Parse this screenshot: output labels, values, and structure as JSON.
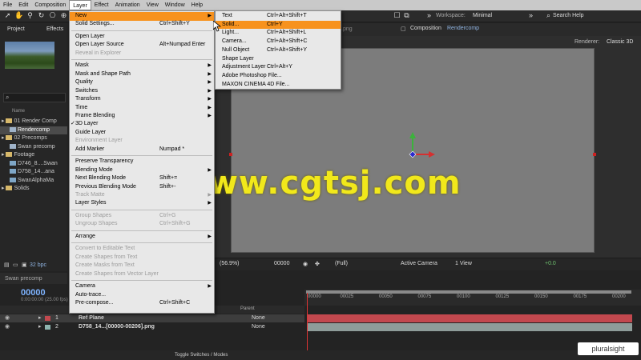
{
  "menubar": {
    "items": [
      "File",
      "Edit",
      "Composition",
      "Layer",
      "Effect",
      "Animation",
      "View",
      "Window",
      "Help"
    ],
    "active": "Layer"
  },
  "toolbar": {
    "workspace_label": "Workspace:",
    "workspace_value": "Minimal",
    "search_help": "Search Help"
  },
  "project": {
    "tabs": [
      "Project",
      "Effects"
    ],
    "name_header": "Name",
    "rows": [
      {
        "label": "01 Render Comp",
        "kind": "folder"
      },
      {
        "label": "Rendercomp",
        "kind": "comp",
        "selected": true
      },
      {
        "label": "02 Precomps",
        "kind": "folder"
      },
      {
        "label": "Swan precomp",
        "kind": "comp"
      },
      {
        "label": "Footage",
        "kind": "folder"
      },
      {
        "label": "D746_8....Swan",
        "kind": "footage"
      },
      {
        "label": "D758_14...ana",
        "kind": "footage"
      },
      {
        "label": "SwanAlphaMa",
        "kind": "footage"
      },
      {
        "label": "Solids",
        "kind": "folder"
      }
    ],
    "bpc": "32 bpc"
  },
  "composition": {
    "tab_label": "Composition",
    "tab_name": "Rendercomp",
    "background_tab_fragment": ".png",
    "renderer_label": "Renderer:",
    "renderer_value": "Classic 3D",
    "bottom": {
      "zoom": "(56.9%)",
      "timecode": "00000",
      "resolution": "(Full)",
      "camera": "Active Camera",
      "views": "1 View",
      "exposure": "+0.0"
    }
  },
  "layer_menu": {
    "items": [
      {
        "label": "New",
        "shortcut": "",
        "submenu": true,
        "highlight": true
      },
      {
        "label": "Solid Settings...",
        "shortcut": "Ctrl+Shift+Y"
      },
      {
        "sep": true
      },
      {
        "label": "Open Layer",
        "shortcut": ""
      },
      {
        "label": "Open Layer Source",
        "shortcut": "Alt+Numpad Enter"
      },
      {
        "label": "Reveal in Explorer",
        "shortcut": "",
        "disabled": true
      },
      {
        "sep": true
      },
      {
        "label": "Mask",
        "submenu": true
      },
      {
        "label": "Mask and Shape Path",
        "submenu": true
      },
      {
        "label": "Quality",
        "submenu": true
      },
      {
        "label": "Switches",
        "submenu": true
      },
      {
        "label": "Transform",
        "submenu": true
      },
      {
        "label": "Time",
        "submenu": true
      },
      {
        "label": "Frame Blending",
        "submenu": true
      },
      {
        "label": "3D Layer",
        "checked": true
      },
      {
        "label": "Guide Layer"
      },
      {
        "label": "Environment Layer",
        "disabled": true
      },
      {
        "label": "Add Marker",
        "shortcut": "Numpad *"
      },
      {
        "sep": true
      },
      {
        "label": "Preserve Transparency"
      },
      {
        "label": "Blending Mode",
        "submenu": true
      },
      {
        "label": "Next Blending Mode",
        "shortcut": "Shift+="
      },
      {
        "label": "Previous Blending Mode",
        "shortcut": "Shift+-"
      },
      {
        "label": "Track Matte",
        "submenu": true,
        "disabled": true
      },
      {
        "label": "Layer Styles",
        "submenu": true
      },
      {
        "sep": true
      },
      {
        "label": "Group Shapes",
        "shortcut": "Ctrl+G",
        "disabled": true
      },
      {
        "label": "Ungroup Shapes",
        "shortcut": "Ctrl+Shift+G",
        "disabled": true
      },
      {
        "sep": true
      },
      {
        "label": "Arrange",
        "submenu": true
      },
      {
        "sep": true
      },
      {
        "label": "Convert to Editable Text",
        "disabled": true
      },
      {
        "label": "Create Shapes from Text",
        "disabled": true
      },
      {
        "label": "Create Masks from Text",
        "disabled": true
      },
      {
        "label": "Create Shapes from Vector Layer",
        "disabled": true
      },
      {
        "sep": true
      },
      {
        "label": "Camera",
        "submenu": true
      },
      {
        "label": "Auto-trace..."
      },
      {
        "label": "Pre-compose...",
        "shortcut": "Ctrl+Shift+C"
      }
    ]
  },
  "new_submenu": {
    "items": [
      {
        "label": "Text",
        "shortcut": "Ctrl+Alt+Shift+T"
      },
      {
        "label": "Solid...",
        "shortcut": "Ctrl+Y",
        "highlight": true
      },
      {
        "label": "Light...",
        "shortcut": "Ctrl+Alt+Shift+L"
      },
      {
        "label": "Camera...",
        "shortcut": "Ctrl+Alt+Shift+C"
      },
      {
        "label": "Null Object",
        "shortcut": "Ctrl+Alt+Shift+Y"
      },
      {
        "label": "Shape Layer",
        "shortcut": ""
      },
      {
        "label": "Adjustment Layer",
        "shortcut": "Ctrl+Alt+Y"
      },
      {
        "label": "Adobe Photoshop File...",
        "shortcut": ""
      },
      {
        "label": "MAXON CINEMA 4D File...",
        "shortcut": ""
      }
    ]
  },
  "timeline": {
    "tab_label": "Swan precomp",
    "timecode": "00000",
    "fps": "0:00:00:00 (25.00 fps)",
    "parent_header": "Parent",
    "ticks": [
      "00000",
      "00025",
      "00050",
      "00075",
      "00100",
      "00125",
      "00150",
      "00175",
      "00200"
    ],
    "layers": [
      {
        "num": "1",
        "name": "Ref Plane",
        "color": "#c2484e",
        "parent": "None",
        "selected": true
      },
      {
        "num": "2",
        "name": "D758_14...[00000-00206].png",
        "color": "#8fb5b0",
        "parent": "None"
      }
    ],
    "toggle_label": "Toggle Switches / Modes"
  },
  "watermark": "www.cgtsj.com",
  "branding": "pluralsight"
}
